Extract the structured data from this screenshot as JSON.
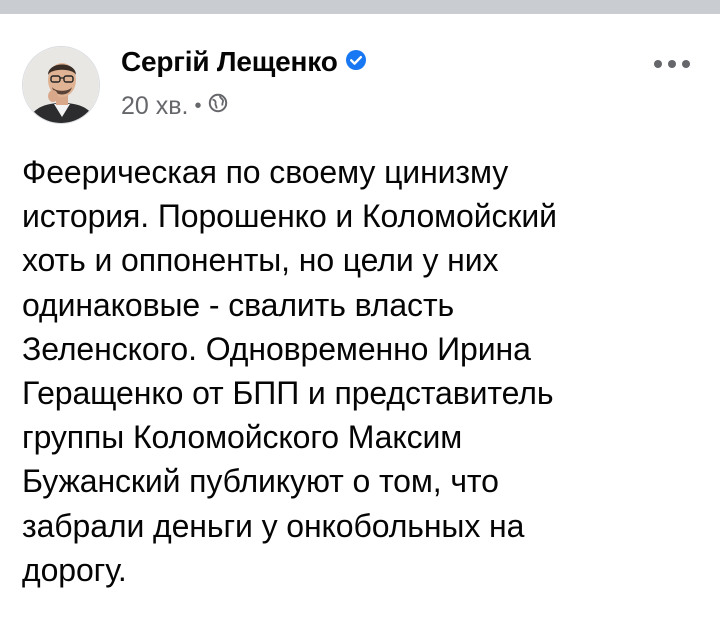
{
  "post": {
    "author_name": "Сергій Лещенко",
    "timestamp": "20 хв.",
    "separator": "•",
    "privacy_icon": "globe-icon",
    "verified_icon": "verified-badge-icon",
    "more_icon": "more-options-icon",
    "text": "Феерическая по своему цинизму\nистория. Порошенко и Коломойский\nхоть и оппоненты, но цели у них\nодинаковые - свалить власть\nЗеленского. Одновременно Ирина\nГеращенко от БПП и представитель\nгруппы Коломойского Максим\nБужанский публикуют о том, что\nзабрали деньги у онкобольных на\nдорогу."
  },
  "colors": {
    "name": "#050505",
    "meta": "#65676b",
    "verified": "#1877f2",
    "divider": "#c9ccd1"
  }
}
